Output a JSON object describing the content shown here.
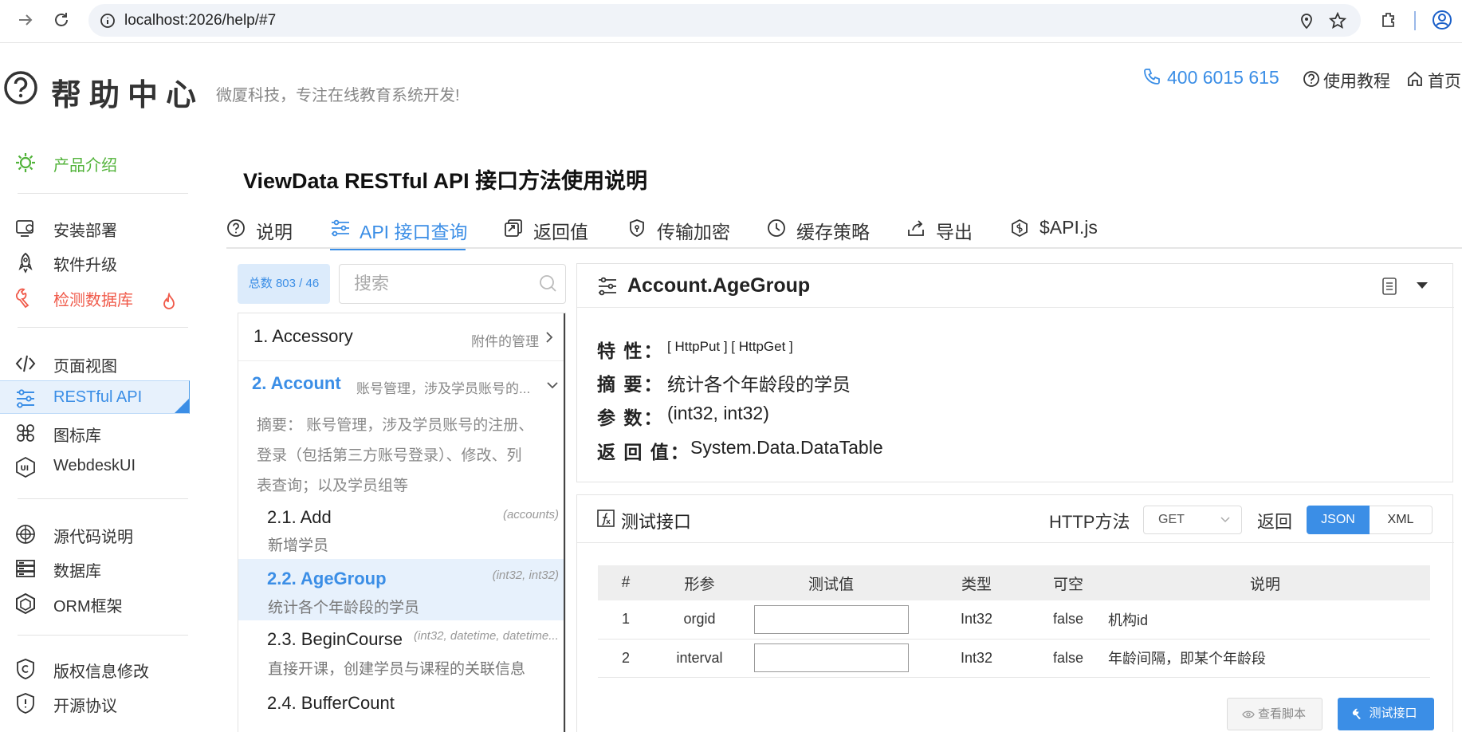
{
  "browser": {
    "url": "localhost:2026/help/#7"
  },
  "header": {
    "title": "帮助中心",
    "tagline": "微厦科技，专注在线教育系统开发!",
    "phone": "400 6015 615",
    "tutorial_label": "使用教程",
    "home_label": "首页"
  },
  "sidebar": {
    "items": [
      {
        "label": "产品介绍",
        "icon": "sun-icon"
      },
      {
        "label": "安装部署",
        "icon": "install-icon"
      },
      {
        "label": "软件升级",
        "icon": "rocket-icon"
      },
      {
        "label": "检测数据库",
        "icon": "wrench-icon"
      },
      {
        "label": "页面视图",
        "icon": "code-icon"
      },
      {
        "label": "RESTful API",
        "icon": "sliders-icon"
      },
      {
        "label": "图标库",
        "icon": "command-icon"
      },
      {
        "label": "WebdeskUI",
        "icon": "ui-icon"
      },
      {
        "label": "源代码说明",
        "icon": "source-icon"
      },
      {
        "label": "数据库",
        "icon": "server-icon"
      },
      {
        "label": "ORM框架",
        "icon": "cube-icon"
      },
      {
        "label": "版权信息修改",
        "icon": "copyright-icon"
      },
      {
        "label": "开源协议",
        "icon": "shield-icon"
      }
    ]
  },
  "page": {
    "title": "ViewData RESTful API 接口方法使用说明"
  },
  "tabs": [
    {
      "label": "说明"
    },
    {
      "label": "API 接口查询"
    },
    {
      "label": "返回值"
    },
    {
      "label": "传输加密"
    },
    {
      "label": "缓存策略"
    },
    {
      "label": "导出"
    },
    {
      "label": "$API.js"
    }
  ],
  "list": {
    "count": "总数 803 / 46",
    "search_placeholder": "搜索",
    "groups": [
      {
        "num": "1. Accessory",
        "note": "附件的管理"
      },
      {
        "num": "2. Account",
        "note": "账号管理，涉及学员账号的...",
        "summary_lines": [
          "摘要：  账号管理，涉及学员账号的注册、",
          "登录（包括第三方账号登录）、修改、列",
          "表查询；以及学员组等"
        ]
      }
    ],
    "methods": [
      {
        "num": "2.1. Add",
        "sig": "(accounts)",
        "desc": "新增学员"
      },
      {
        "num": "2.2. AgeGroup",
        "sig": "(int32, int32)",
        "desc": "统计各个年龄段的学员"
      },
      {
        "num": "2.3. BeginCourse",
        "sig": "(int32, datetime, datetime...",
        "desc": "直接开课，创建学员与课程的关联信息"
      },
      {
        "num": "2.4. BufferCount",
        "sig": "",
        "desc": ""
      }
    ]
  },
  "detail": {
    "title": "Account.AgeGroup",
    "attr_label": "特 性：",
    "attr_value": "[ HttpPut ]  [ HttpGet ]",
    "summary_label": "摘 要：",
    "summary_value": "统计各个年龄段的学员",
    "params_label": "参 数：",
    "params_value": "(int32, int32)",
    "return_label": "返 回 值：",
    "return_value": "System.Data.DataTable"
  },
  "test": {
    "title": "测试接口",
    "http_label": "HTTP方法",
    "method": "GET",
    "return_label": "返回",
    "json_label": "JSON",
    "xml_label": "XML",
    "columns": [
      "#",
      "形参",
      "测试值",
      "类型",
      "可空",
      "说明"
    ],
    "rows": [
      {
        "idx": "1",
        "name": "orgid",
        "type": "Int32",
        "nullable": "false",
        "desc": "机构id"
      },
      {
        "idx": "2",
        "name": "interval",
        "type": "Int32",
        "nullable": "false",
        "desc": "年龄间隔，即某个年龄段"
      }
    ],
    "view_script_label": "查看脚本",
    "test_button_label": "测试接口"
  },
  "colors": {
    "accent": "#3b8ee6",
    "active_bg": "#e7f1fc",
    "danger": "#f05a4a",
    "green": "#52b33a"
  }
}
